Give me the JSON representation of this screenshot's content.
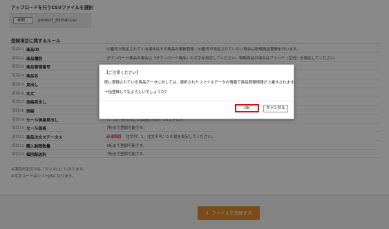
{
  "upload": {
    "section_title": "アップロードを行うCSVファイルを選択",
    "browse_label": "参照...",
    "file_name": "product_format.csv"
  },
  "rules": {
    "section_title": "登録項目に関するルール",
    "rows": [
      {
        "no": "項目01",
        "name": "商品ID",
        "desc": "ID番号が設定されている場合はその商品の更新登録／ID番号が設定されていない場合は新規商品登録を行います。"
      },
      {
        "no": "項目02",
        "name": "商品種別",
        "desc": "ダウンロード商品の場合は「ダウンロード商品」の文字を設定してください。物販商品の場合はブランク（空白）を設定してください。"
      },
      {
        "no": "項目03",
        "name": "商品管理番号",
        "desc": ""
      },
      {
        "no": "項目04",
        "name": "商品名",
        "desc": ""
      },
      {
        "no": "項目05",
        "name": "見出し",
        "desc": ""
      },
      {
        "no": "項目06",
        "name": "本文",
        "desc": ""
      },
      {
        "no": "項目07",
        "name": "価格見出し",
        "desc": ""
      },
      {
        "no": "項目08",
        "name": "価格",
        "desc": ""
      },
      {
        "no": "項目09",
        "name": "セール価格見出し",
        "desc": "セールや割引などの価格の名称／50文字以内"
      },
      {
        "no": "項目10",
        "name": "セール価格",
        "desc": "7桁まで登録可能です。"
      },
      {
        "no": "項目11",
        "name": "商品注文ステータス",
        "required": "必須項目",
        "desc": "注文可：1、注文不可：0 の値を設定してください。"
      },
      {
        "no": "項目12",
        "name": "購入制限数量",
        "desc": "2桁まで登録可能です。"
      },
      {
        "no": "項目13",
        "name": "個別配送料",
        "desc": "7桁まで登録可能です。"
      }
    ]
  },
  "notes": [
    "※項目の区切りは「カンマ(,)」になります。",
    "※文字コードはシフトJISになります。"
  ],
  "footer": {
    "submit_label": "ファイルを登録する"
  },
  "dialog": {
    "title": "【ご注意ください】",
    "message1": "既に登録されている商品データに対しては、選択されたファイルデータの情報で商品登録情報が上書きされます。",
    "message2": "一括登録してもよろしいでしょうか?",
    "ok_label": "OK",
    "cancel_label": "キャンセル"
  },
  "colors": {
    "accent": "#e08a2c",
    "highlight": "#d0141e",
    "required": "#c0392b"
  }
}
